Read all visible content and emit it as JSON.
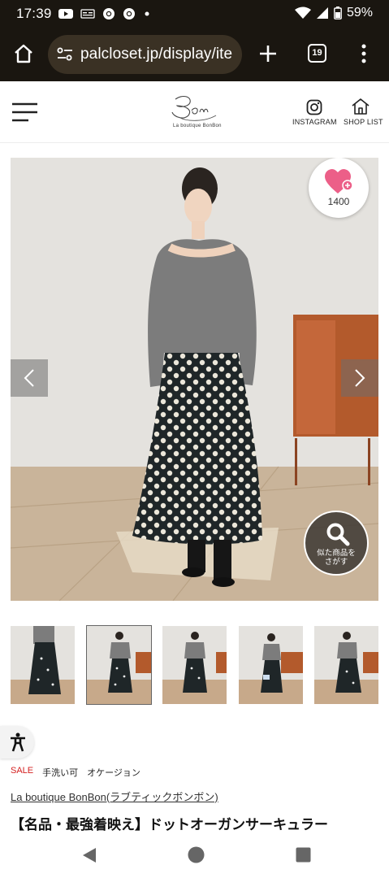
{
  "status_bar": {
    "time": "17:39",
    "battery": "59%",
    "notification_icons": [
      "youtube-icon",
      "news-icon",
      "chrome-icon",
      "chrome-icon",
      "dot-icon"
    ],
    "system_icons": [
      "wifi-icon",
      "signal-icon",
      "battery-icon"
    ]
  },
  "browser": {
    "url": "palcloset.jp/display/ite",
    "tab_count": "19"
  },
  "site_header": {
    "logo_text": "Bon Bon",
    "logo_subtitle": "La boutique BonBon",
    "instagram_label": "INSTAGRAM",
    "shoplist_label": "SHOP LIST"
  },
  "product": {
    "favorite_count": "1400",
    "similar_button_label_line1": "似た商品を",
    "similar_button_label_line2": "さがす",
    "thumbnail_count": 5,
    "selected_thumbnail": 2,
    "tags": {
      "sale": "SALE",
      "tag1": "手洗い可",
      "tag2": "オケージョン"
    },
    "brand": "La boutique BonBon(ラブティックボンボン)",
    "title": "【名品・最強着映え】ドットオーガンサーキュラー"
  },
  "colors": {
    "status_bg": "#1a1610",
    "url_pill_bg": "#3a3124",
    "favorite_heart": "#ec5f88",
    "sale_red": "#d42020"
  }
}
